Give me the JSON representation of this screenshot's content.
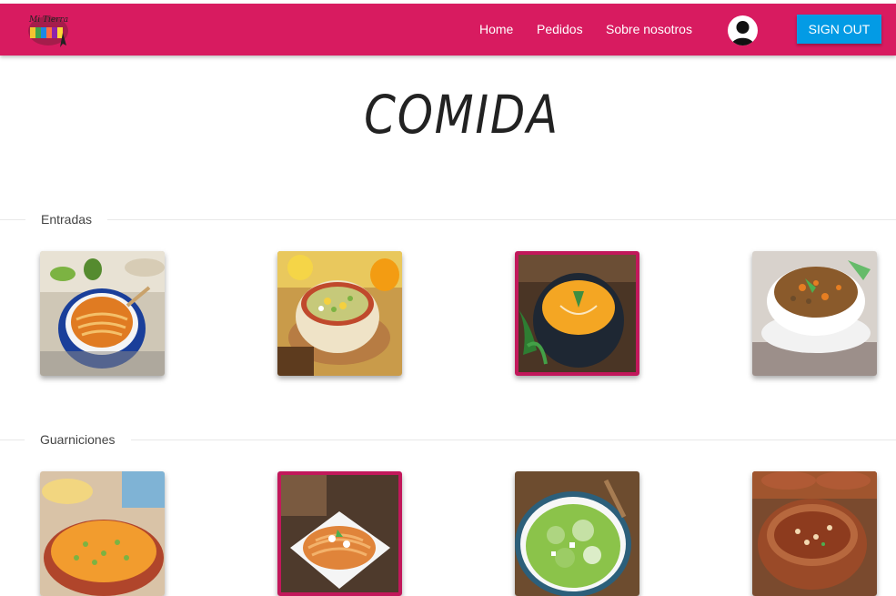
{
  "header": {
    "logo_text": "Mi Tierra",
    "nav": [
      "Home",
      "Pedidos",
      "Sobre nosotros"
    ],
    "signout_label": "SIGN OUT",
    "brand_color": "#d81b60",
    "signout_color": "#039be5"
  },
  "page": {
    "title": "COMIDA"
  },
  "sections": [
    {
      "label": "Entradas",
      "items": [
        {
          "icon": "noodle-soup-image",
          "selected": false
        },
        {
          "icon": "vegetable-soup-image",
          "selected": false
        },
        {
          "icon": "pumpkin-cream-soup-image",
          "selected": true
        },
        {
          "icon": "lentil-soup-image",
          "selected": false
        }
      ]
    },
    {
      "label": "Guarniciones",
      "items": [
        {
          "icon": "mexican-rice-image",
          "selected": false
        },
        {
          "icon": "spaghetti-image",
          "selected": true
        },
        {
          "icon": "green-salad-image",
          "selected": false
        },
        {
          "icon": "bean-stew-image",
          "selected": false
        }
      ]
    }
  ]
}
